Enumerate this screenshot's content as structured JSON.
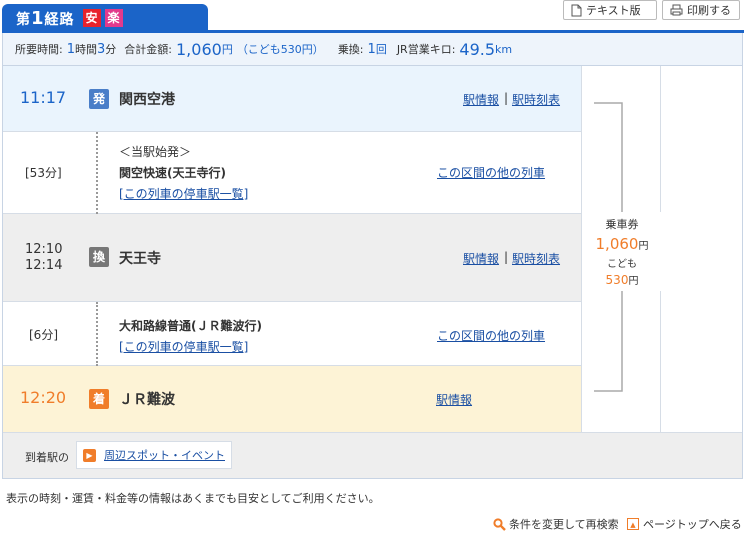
{
  "route": {
    "label_pre": "第",
    "number": "1",
    "label_post": "経路",
    "badges": [
      "安",
      "楽"
    ]
  },
  "buttons": {
    "text_version": "テキスト版",
    "print": "印刷する"
  },
  "summary": {
    "time_label": "所要時間:",
    "time_h": "1",
    "time_h_unit": "時間",
    "time_m": "3",
    "time_m_unit": "分",
    "fare_label": "合計金額:",
    "fare": "1,060",
    "fare_unit": "円",
    "child_fare": "（こども530円）",
    "transfer_label": "乗換:",
    "transfer_count": "1",
    "transfer_unit": "回",
    "km_label": "JR営業キロ:",
    "km": "49.5",
    "km_unit": "km"
  },
  "stations": [
    {
      "time": "11:17",
      "icon": "発",
      "name": "関西空港",
      "link1": "駅情報",
      "link2": "駅時刻表"
    },
    {
      "time_arr": "12:10",
      "time_dep": "12:14",
      "icon": "換",
      "name": "天王寺",
      "link1": "駅情報",
      "link2": "駅時刻表"
    },
    {
      "time": "12:20",
      "icon": "着",
      "name": "ＪＲ難波",
      "link1": "駅情報"
    }
  ],
  "segments": [
    {
      "duration": "[53分]",
      "note": "＜当駅始発＞",
      "train": "関空快速(天王寺行)",
      "stops_link": "[この列車の停車駅一覧]",
      "other_link": "この区間の他の列車"
    },
    {
      "duration": "[6分]",
      "train": "大和路線普通(ＪＲ難波行)",
      "stops_link": "[この列車の停車駅一覧]",
      "other_link": "この区間の他の列車"
    }
  ],
  "fare_box": {
    "title": "乗車券",
    "amount": "1,060",
    "unit": "円",
    "child_label": "こども",
    "child_amount": "530",
    "child_unit": "円"
  },
  "arrival": {
    "label": "到着駅の",
    "spot_link": "周辺スポット・イベント"
  },
  "notice": "表示の時刻・運賃・料金等の情報はあくまでも目安としてご利用ください。",
  "footer": {
    "research": "条件を変更して再検索",
    "page_top": "ページトップへ戻る"
  },
  "colors": {
    "accent": "#1b64c8",
    "depart": "#4a7ec8",
    "transfer": "#777777",
    "arrive": "#f07d2a",
    "fare": "#f07d2a"
  }
}
